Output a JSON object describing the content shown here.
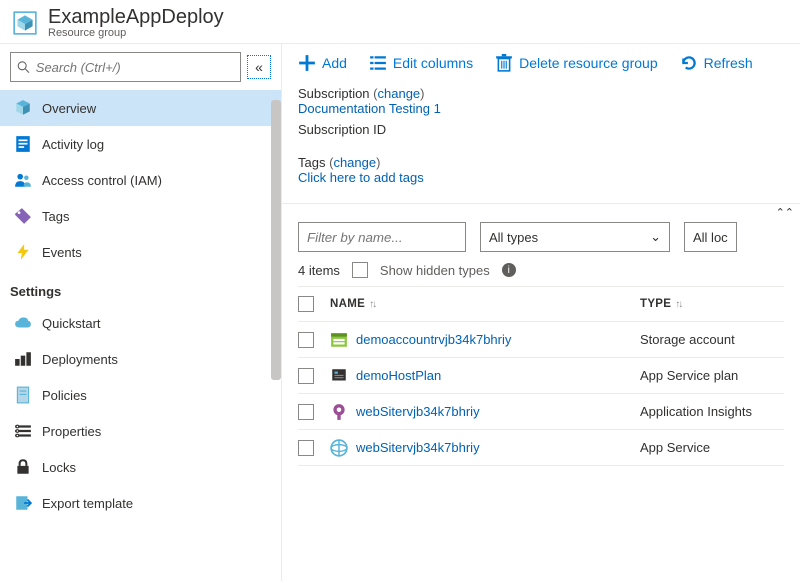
{
  "header": {
    "title": "ExampleAppDeploy",
    "subtitle": "Resource group"
  },
  "search": {
    "placeholder": "Search (Ctrl+/)"
  },
  "sidebar": {
    "items": [
      {
        "label": "Overview",
        "icon": "cube"
      },
      {
        "label": "Activity log",
        "icon": "log"
      },
      {
        "label": "Access control (IAM)",
        "icon": "people"
      },
      {
        "label": "Tags",
        "icon": "tag"
      },
      {
        "label": "Events",
        "icon": "bolt"
      }
    ],
    "section_label": "Settings",
    "settings": [
      {
        "label": "Quickstart",
        "icon": "cloud"
      },
      {
        "label": "Deployments",
        "icon": "deploy"
      },
      {
        "label": "Policies",
        "icon": "policy"
      },
      {
        "label": "Properties",
        "icon": "props"
      },
      {
        "label": "Locks",
        "icon": "lock"
      },
      {
        "label": "Export template",
        "icon": "export"
      }
    ]
  },
  "toolbar": {
    "add": "Add",
    "edit_columns": "Edit columns",
    "delete": "Delete resource group",
    "refresh": "Refresh"
  },
  "info": {
    "subscription_label": "Subscription",
    "change": "change",
    "subscription_name": "Documentation Testing 1",
    "subscription_id_label": "Subscription ID",
    "tags_label": "Tags",
    "tags_link": "Click here to add tags"
  },
  "filters": {
    "filter_placeholder": "Filter by name...",
    "type_filter": "All types",
    "loc_filter": "All loc"
  },
  "list": {
    "count_label": "4 items",
    "show_hidden": "Show hidden types",
    "col_name": "NAME",
    "col_type": "TYPE",
    "rows": [
      {
        "name": "demoaccountrvjb34k7bhriy",
        "type": "Storage account",
        "icon": "storage"
      },
      {
        "name": "demoHostPlan",
        "type": "App Service plan",
        "icon": "plan"
      },
      {
        "name": "webSitervjb34k7bhriy",
        "type": "Application Insights",
        "icon": "insights"
      },
      {
        "name": "webSitervjb34k7bhriy",
        "type": "App Service",
        "icon": "appservice"
      }
    ]
  }
}
